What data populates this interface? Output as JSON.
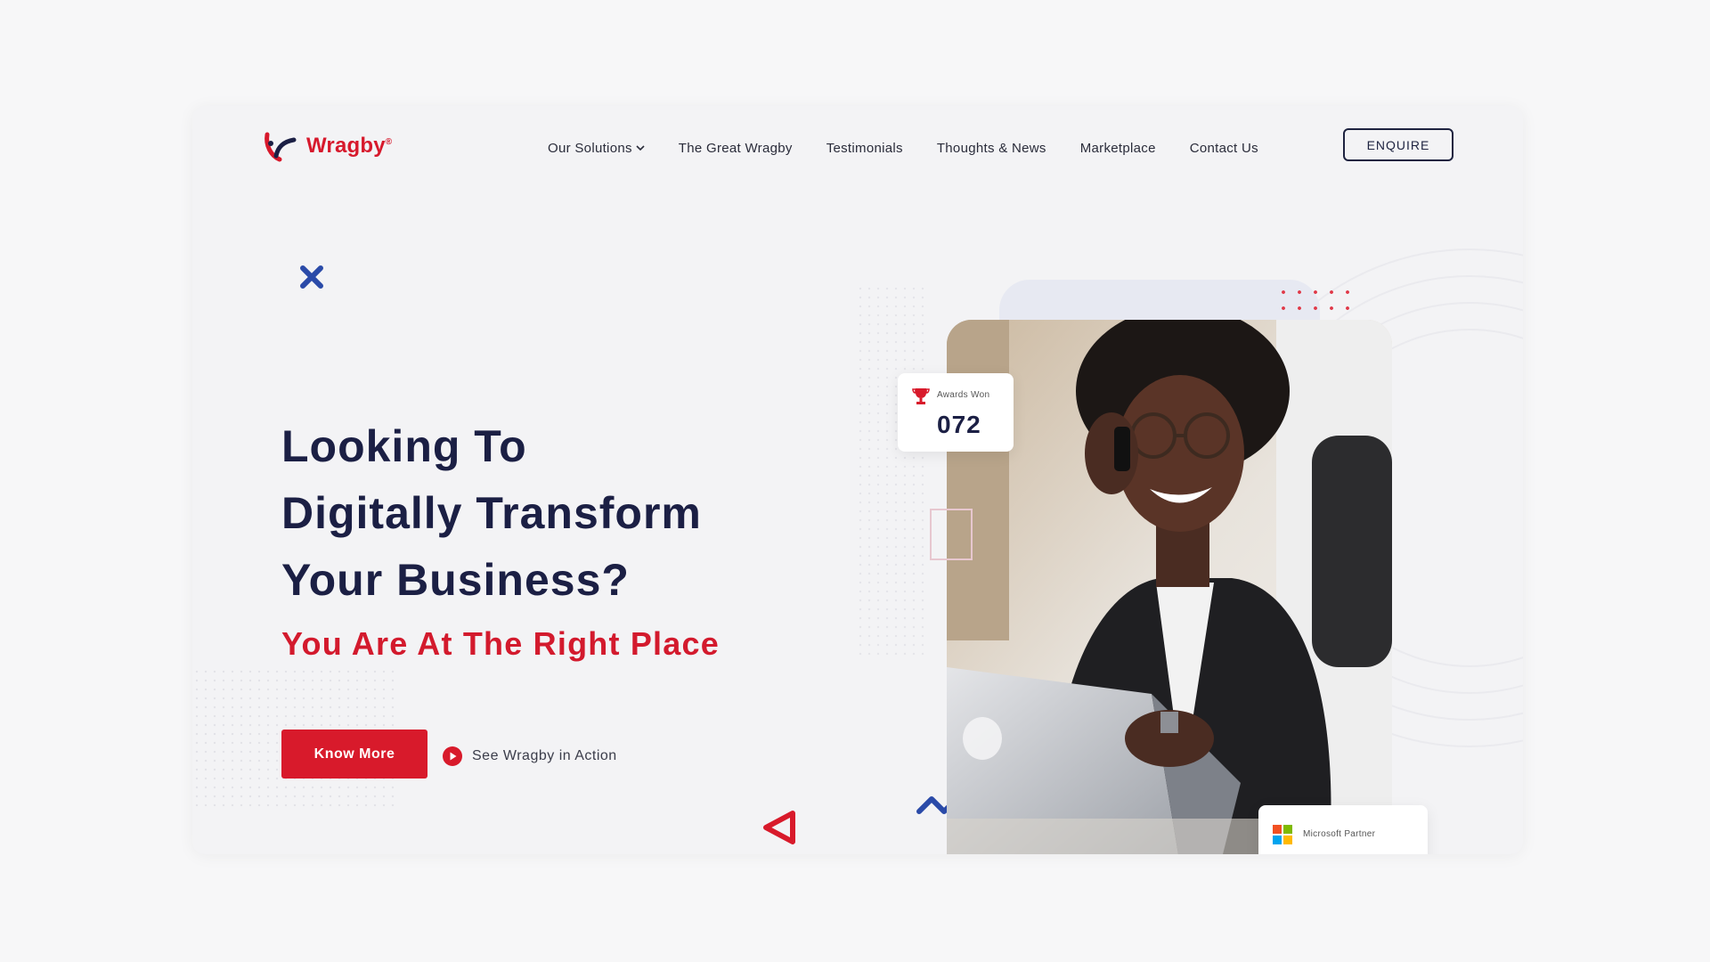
{
  "brand": {
    "name": "Wragby",
    "trademark": "®",
    "color": "#d7192c"
  },
  "nav": {
    "items": [
      {
        "label": "Our Solutions",
        "has_dropdown": true
      },
      {
        "label": "The Great Wragby"
      },
      {
        "label": "Testimonials"
      },
      {
        "label": "Thoughts & News"
      },
      {
        "label": "Marketplace"
      },
      {
        "label": "Contact Us"
      }
    ],
    "enquire_label": "ENQUIRE"
  },
  "hero": {
    "title_lines": [
      "Looking To",
      "Digitally Transform",
      "Your Business?"
    ],
    "subtitle": "You Are At The Right Place",
    "cta_primary": "Know More",
    "cta_secondary": "See Wragby in Action"
  },
  "awards": {
    "label": "Awards Won",
    "value": "072",
    "icon": "trophy-icon"
  },
  "partner": {
    "label": "Microsoft Partner",
    "icon": "microsoft-logo-icon"
  },
  "colors": {
    "primary_red": "#d81a2b",
    "navy": "#1b1f44",
    "accent_blue": "#2a4aa8"
  }
}
